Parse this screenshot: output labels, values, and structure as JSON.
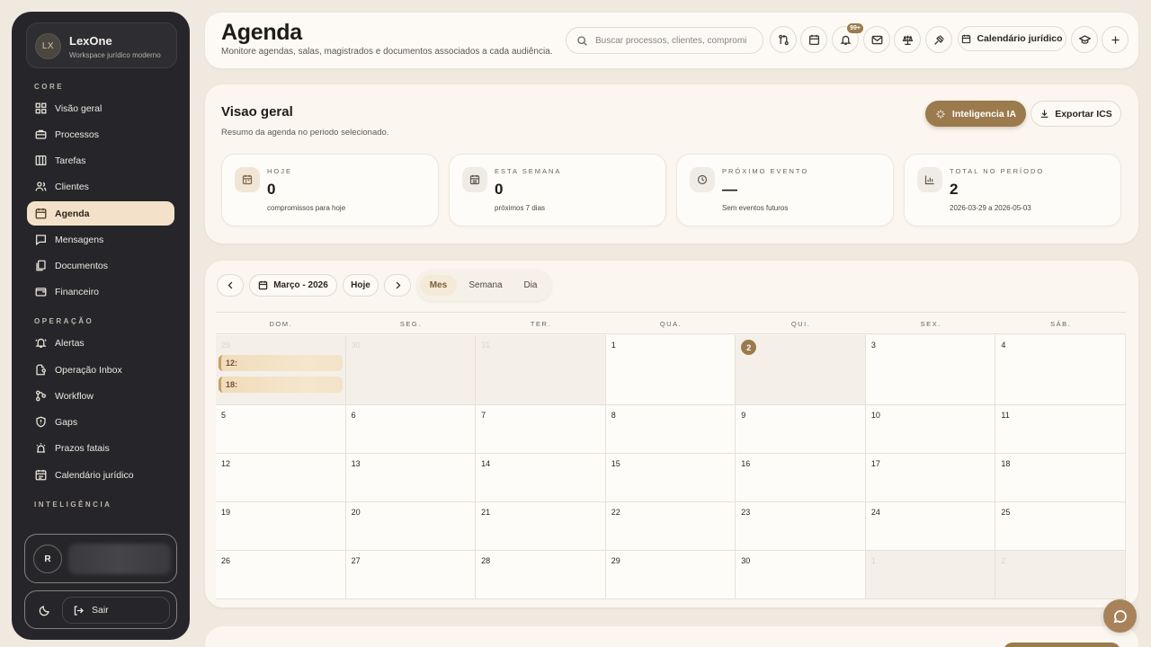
{
  "brand": {
    "logo": "LX",
    "name": "LexOne",
    "subtitle": "Workspace jurídico moderno"
  },
  "sidebar": {
    "sections": [
      {
        "label": "CORE",
        "items": [
          {
            "label": "Visão geral",
            "icon": "grid-icon"
          },
          {
            "label": "Processos",
            "icon": "briefcase-icon"
          },
          {
            "label": "Tarefas",
            "icon": "columns-icon"
          },
          {
            "label": "Clientes",
            "icon": "users-icon"
          },
          {
            "label": "Agenda",
            "icon": "calendar-icon",
            "active": true
          },
          {
            "label": "Mensagens",
            "icon": "message-icon"
          },
          {
            "label": "Documentos",
            "icon": "documents-icon"
          },
          {
            "label": "Financeiro",
            "icon": "wallet-icon"
          }
        ]
      },
      {
        "label": "OPERAÇÃO",
        "items": [
          {
            "label": "Alertas",
            "icon": "bell-alert-icon"
          },
          {
            "label": "Operação Inbox",
            "icon": "inbox-icon"
          },
          {
            "label": "Workflow",
            "icon": "workflow-icon"
          },
          {
            "label": "Gaps",
            "icon": "shield-icon"
          },
          {
            "label": "Prazos fatais",
            "icon": "siren-icon"
          },
          {
            "label": "Calendário jurídico",
            "icon": "calendar-check-icon"
          }
        ]
      },
      {
        "label": "INTELIGÊNCIA",
        "items": []
      }
    ],
    "user": {
      "initial": "R"
    },
    "logout_label": "Sair"
  },
  "header": {
    "title": "Agenda",
    "subtitle": "Monitore agendas, salas, magistrados e documentos associados a cada audiência.",
    "search_placeholder": "Buscar processos, clientes, compromissos",
    "notifications_badge": "99+",
    "calendar_button": "Calendário jurídico"
  },
  "overview": {
    "title": "Visao geral",
    "subtitle": "Resumo da agenda no periodo selecionado.",
    "ai_button": "Inteligencia IA",
    "export_button": "Exportar ICS",
    "stats": [
      {
        "label": "HOJE",
        "value": "0",
        "note": "compromissos para hoje",
        "icon": "calendar-icon"
      },
      {
        "label": "ESTA SEMANA",
        "value": "0",
        "note": "próximos 7 dias",
        "icon": "calendar-week-icon"
      },
      {
        "label": "PRÓXIMO EVENTO",
        "value": "—",
        "note": "Sem eventos futuros",
        "icon": "clock-icon"
      },
      {
        "label": "TOTAL NO PERÍODO",
        "value": "2",
        "note": "2026-03-29 a 2026-05-03",
        "icon": "bar-chart-icon"
      }
    ]
  },
  "calendar": {
    "month_label": "Março - 2026",
    "today_label": "Hoje",
    "views": [
      "Mes",
      "Semana",
      "Dia"
    ],
    "active_view": "Mes",
    "weekdays": [
      "DOM.",
      "SEG.",
      "TER.",
      "QUA.",
      "QUI.",
      "SEX.",
      "SÁB."
    ],
    "weeks": [
      [
        "29",
        "30",
        "31",
        "1",
        "2",
        "3",
        "4"
      ],
      [
        "5",
        "6",
        "7",
        "8",
        "9",
        "10",
        "11"
      ],
      [
        "12",
        "13",
        "14",
        "15",
        "16",
        "17",
        "18"
      ],
      [
        "19",
        "20",
        "21",
        "22",
        "23",
        "24",
        "25"
      ],
      [
        "26",
        "27",
        "28",
        "29",
        "30",
        "1",
        "2"
      ]
    ],
    "events": [
      "12:",
      "18:"
    ]
  }
}
